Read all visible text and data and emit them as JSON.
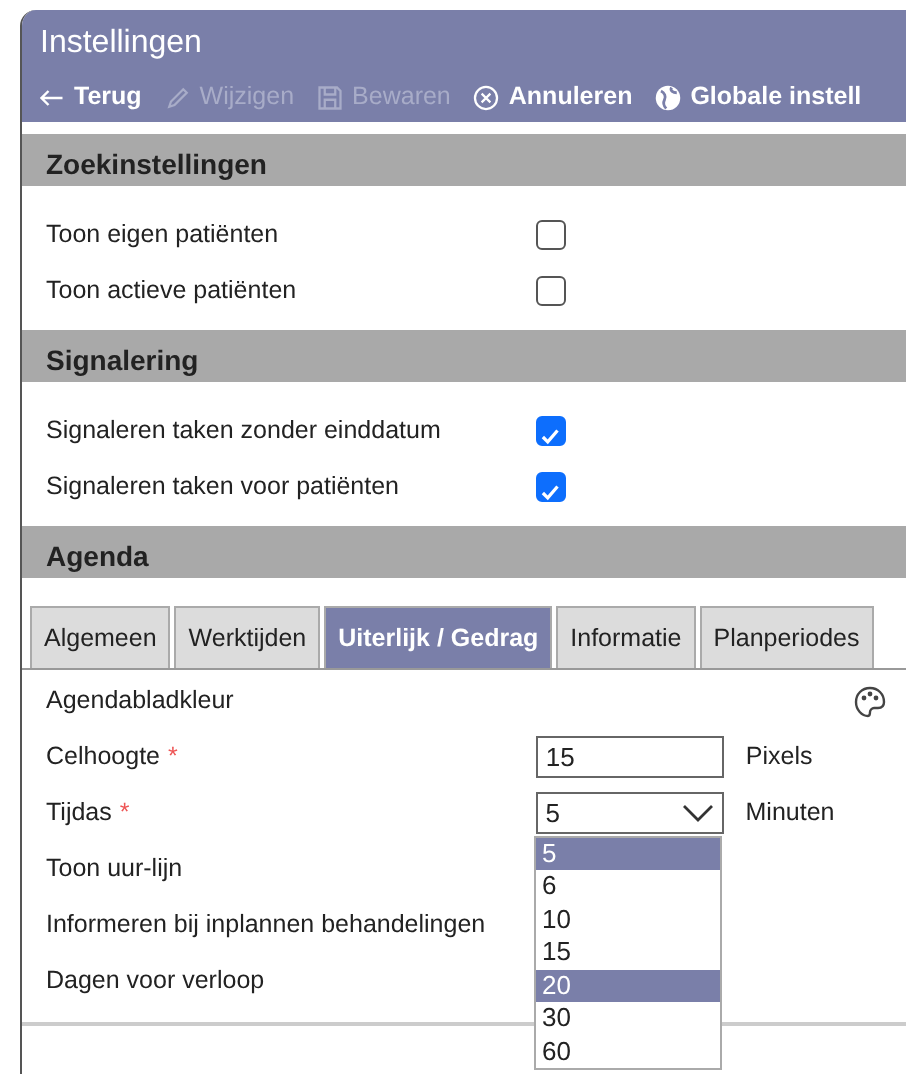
{
  "window": {
    "title": "Instellingen"
  },
  "toolbar": [
    {
      "kind": "back",
      "label": "Terug",
      "disabled": false
    },
    {
      "kind": "edit",
      "label": "Wijzigen",
      "disabled": true
    },
    {
      "kind": "save",
      "label": "Bewaren",
      "disabled": true
    },
    {
      "kind": "cancel",
      "label": "Annuleren",
      "disabled": false
    },
    {
      "kind": "globe",
      "label": "Globale instell",
      "disabled": false
    }
  ],
  "sections": [
    {
      "title": "Zoekinstellingen",
      "rows": [
        {
          "kind": "checkbox",
          "label": "Toon eigen patiënten",
          "checked": false
        },
        {
          "kind": "checkbox",
          "label": "Toon actieve patiënten",
          "checked": false
        }
      ]
    },
    {
      "title": "Signalering",
      "rows": [
        {
          "kind": "checkbox",
          "label": "Signaleren taken zonder einddatum",
          "checked": true
        },
        {
          "kind": "checkbox",
          "label": "Signaleren taken voor patiënten",
          "checked": true
        }
      ]
    },
    {
      "title": "Agenda",
      "tabs": [
        {
          "label": "Algemeen",
          "selected": false
        },
        {
          "label": "Werktijden",
          "selected": false
        },
        {
          "label": "Uiterlijk / Gedrag",
          "selected": true
        },
        {
          "label": "Informatie",
          "selected": false
        },
        {
          "label": "Planperiodes",
          "selected": false
        }
      ],
      "rows": [
        {
          "kind": "color",
          "label": "Agendabladkleur"
        },
        {
          "kind": "number",
          "label": "Celhoogte",
          "required_mark": "*",
          "value": "15",
          "unit": "Pixels"
        },
        {
          "kind": "select",
          "label": "Tijdas",
          "required_mark": "*",
          "value": "5",
          "unit": "Minuten",
          "options": [
            {
              "label": "5",
              "highlighted": true
            },
            {
              "label": "6",
              "highlighted": false
            },
            {
              "label": "10",
              "highlighted": false
            },
            {
              "label": "15",
              "highlighted": false
            },
            {
              "label": "20",
              "highlighted": true
            },
            {
              "label": "30",
              "highlighted": false
            },
            {
              "label": "60",
              "highlighted": false
            }
          ]
        },
        {
          "kind": "text",
          "label": "Toon uur-lijn"
        },
        {
          "kind": "text",
          "label": "Informeren bij inplannen behandelingen"
        },
        {
          "kind": "text",
          "label": "Dagen voor verloop"
        }
      ]
    }
  ]
}
